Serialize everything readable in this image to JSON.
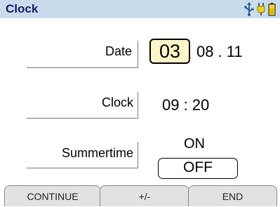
{
  "title": "Clock",
  "status_icons": [
    "usb-icon",
    "plug-icon",
    "battery-icon"
  ],
  "colors": {
    "titlebar": "#c9dceb",
    "title_text": "#1a1a66",
    "highlight": "#fdf6c9"
  },
  "date": {
    "label": "Date",
    "day": "03",
    "rest": "08 . 11"
  },
  "clock": {
    "label": "Clock",
    "value": "09 : 20"
  },
  "summertime": {
    "label": "Summertime",
    "on": "ON",
    "off": "OFF"
  },
  "softkeys": {
    "left": "CONTINUE",
    "middle": "+/-",
    "right": "END"
  }
}
